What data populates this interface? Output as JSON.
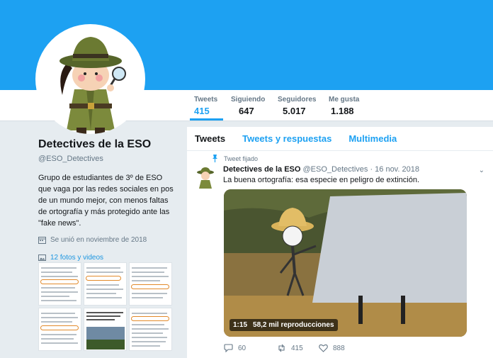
{
  "profile": {
    "name": "Detectives de la ESO",
    "handle": "@ESO_Detectives",
    "bio": "Grupo de estudiantes de 3º de ESO que vaga por las redes sociales en pos de un mundo mejor, con menos faltas de ortografía y más protegido ante las \"fake news\".",
    "joined": "Se unió en noviembre de 2018",
    "media_link": "12 fotos y videos"
  },
  "stats": [
    {
      "label": "Tweets",
      "value": "415"
    },
    {
      "label": "Siguiendo",
      "value": "647"
    },
    {
      "label": "Seguidores",
      "value": "5.017"
    },
    {
      "label": "Me gusta",
      "value": "1.188"
    }
  ],
  "tabs": [
    "Tweets",
    "Tweets y respuestas",
    "Multimedia"
  ],
  "tweet": {
    "pinned_label": "Tweet fijado",
    "author": "Detectives de la ESO",
    "handle_date": "@ESO_Detectives · 16 nov. 2018",
    "text": "La buena ortografía: esa especie en peligro de extinción.",
    "video_time": "1:15",
    "video_views": "58,2 mil reproducciones",
    "replies": "60",
    "retweets": "415",
    "likes": "888"
  },
  "colors": {
    "banner": "#1da1f2",
    "accent": "#1da1f2",
    "page_bg": "#e6ecf0"
  },
  "icons": [
    "detective-avatar",
    "calendar-icon",
    "image-icon",
    "pin-icon",
    "chevron-down-icon",
    "reply-icon",
    "retweet-icon",
    "like-icon"
  ]
}
